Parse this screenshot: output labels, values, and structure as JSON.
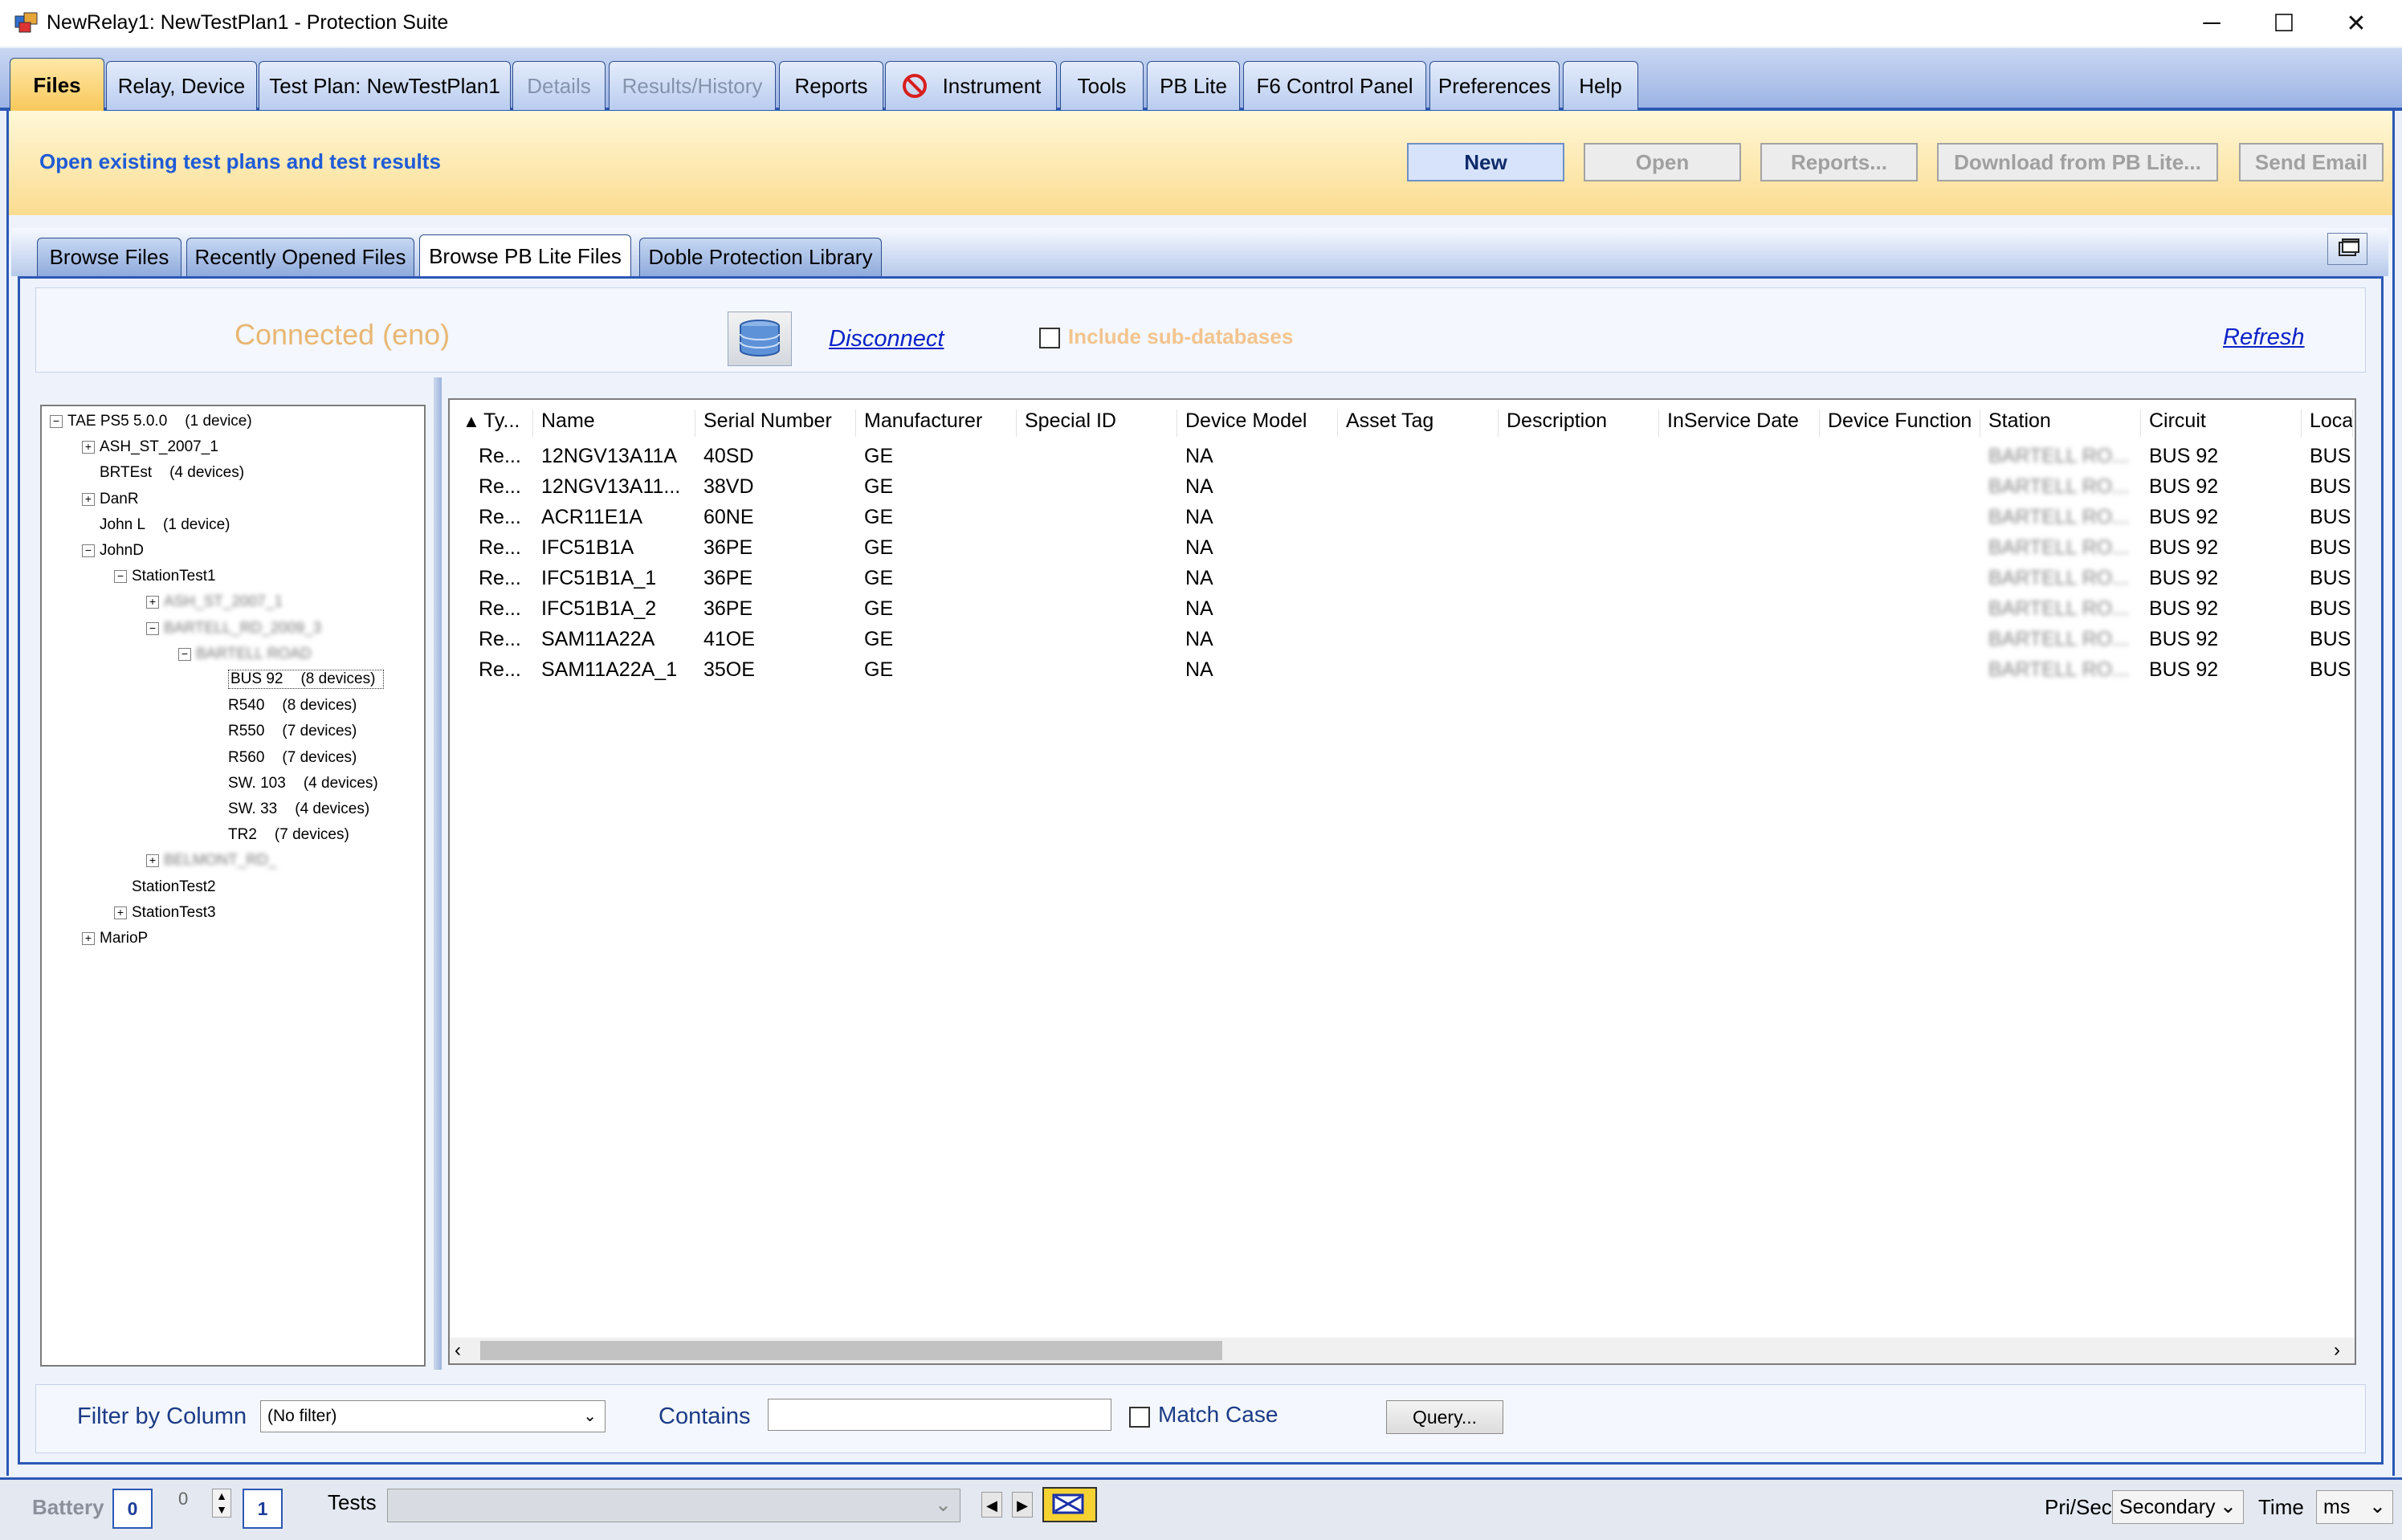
{
  "window": {
    "title": "NewRelay1: NewTestPlan1 - Protection Suite",
    "minimize": "─",
    "maximize": "☐",
    "close": "✕"
  },
  "main_tabs": [
    {
      "label": "Files",
      "state": "active"
    },
    {
      "label": "Relay, Device",
      "state": "normal"
    },
    {
      "label": "Test Plan: NewTestPlan1",
      "state": "normal"
    },
    {
      "label": "Details",
      "state": "disabled"
    },
    {
      "label": "Results/History",
      "state": "disabled"
    },
    {
      "label": "Reports",
      "state": "normal"
    },
    {
      "label": "Instrument",
      "state": "normal",
      "icon": "no-entry-icon"
    },
    {
      "label": "Tools",
      "state": "normal"
    },
    {
      "label": "PB Lite",
      "state": "normal"
    },
    {
      "label": "F6 Control Panel",
      "state": "normal"
    },
    {
      "label": "Preferences",
      "state": "normal"
    },
    {
      "label": "Help",
      "state": "normal"
    }
  ],
  "header": {
    "title": "Open existing test plans and test results",
    "buttons": [
      {
        "label": "New",
        "enabled": true
      },
      {
        "label": "Open",
        "enabled": false
      },
      {
        "label": "Reports...",
        "enabled": false
      },
      {
        "label": "Download from PB Lite...",
        "enabled": false
      },
      {
        "label": "Send Email",
        "enabled": false
      }
    ]
  },
  "sub_tabs": [
    {
      "label": "Browse Files",
      "active": false
    },
    {
      "label": "Recently Opened Files",
      "active": false
    },
    {
      "label": "Browse PB Lite Files",
      "active": true
    },
    {
      "label": "Doble Protection Library",
      "active": false
    }
  ],
  "connection": {
    "status": "Connected (eno)",
    "disconnect": "Disconnect",
    "include_sub": "Include sub-databases",
    "include_sub_checked": false,
    "refresh": "Refresh"
  },
  "tree": [
    {
      "label": "TAE PS5 5.0.0",
      "count": "(1 device)",
      "level": 0,
      "expander": "−"
    },
    {
      "label": "ASH_ST_2007_1",
      "count": "",
      "level": 1,
      "expander": "+"
    },
    {
      "label": "BRTEst",
      "count": "(4 devices)",
      "level": 1,
      "expander": ""
    },
    {
      "label": "DanR",
      "count": "",
      "level": 1,
      "expander": "+"
    },
    {
      "label": "John L",
      "count": "(1 device)",
      "level": 1,
      "expander": ""
    },
    {
      "label": "JohnD",
      "count": "",
      "level": 1,
      "expander": "−"
    },
    {
      "label": "StationTest1",
      "count": "",
      "level": 2,
      "expander": "−"
    },
    {
      "label": "ASH_ST_2007_1",
      "count": "",
      "level": 3,
      "expander": "+",
      "blurred": true
    },
    {
      "label": "BARTELL_RD_2009_3",
      "count": "",
      "level": 3,
      "expander": "−",
      "blurred": true
    },
    {
      "label": "BARTELL ROAD",
      "count": "",
      "level": 4,
      "expander": "−",
      "blurred": true
    },
    {
      "label": "BUS 92",
      "count": "(8 devices)",
      "level": 5,
      "expander": "",
      "selected": true
    },
    {
      "label": "R540",
      "count": "(8 devices)",
      "level": 5,
      "expander": ""
    },
    {
      "label": "R550",
      "count": "(7 devices)",
      "level": 5,
      "expander": ""
    },
    {
      "label": "R560",
      "count": "(7 devices)",
      "level": 5,
      "expander": ""
    },
    {
      "label": "SW. 103",
      "count": "(4 devices)",
      "level": 5,
      "expander": ""
    },
    {
      "label": "SW. 33",
      "count": "(4 devices)",
      "level": 5,
      "expander": ""
    },
    {
      "label": "TR2",
      "count": "(7 devices)",
      "level": 5,
      "expander": ""
    },
    {
      "label": "BELMONT_RD_",
      "count": "",
      "level": 3,
      "expander": "+",
      "blurred": true
    },
    {
      "label": "StationTest2",
      "count": "",
      "level": 2,
      "expander": ""
    },
    {
      "label": "StationTest3",
      "count": "",
      "level": 2,
      "expander": "+"
    },
    {
      "label": "MarioP",
      "count": "",
      "level": 1,
      "expander": "+"
    }
  ],
  "grid": {
    "sort_indicator": "▲",
    "columns": [
      "Ty...",
      "Name",
      "Serial Number",
      "Manufacturer",
      "Special ID",
      "Device Model",
      "Asset Tag",
      "Description",
      "InService Date",
      "Device Function",
      "Station",
      "Circuit",
      "Loca"
    ],
    "rows": [
      [
        "Re...",
        "12NGV13A11A",
        "40SD",
        "GE",
        "",
        "NA",
        "",
        "",
        "",
        "",
        "BARTELL RO...",
        "BUS 92",
        "BUS"
      ],
      [
        "Re...",
        "12NGV13A11...",
        "38VD",
        "GE",
        "",
        "NA",
        "",
        "",
        "",
        "",
        "BARTELL RO...",
        "BUS 92",
        "BUS"
      ],
      [
        "Re...",
        "ACR11E1A",
        "60NE",
        "GE",
        "",
        "NA",
        "",
        "",
        "",
        "",
        "BARTELL RO...",
        "BUS 92",
        "BUS"
      ],
      [
        "Re...",
        "IFC51B1A",
        "36PE",
        "GE",
        "",
        "NA",
        "",
        "",
        "",
        "",
        "BARTELL RO...",
        "BUS 92",
        "BUS"
      ],
      [
        "Re...",
        "IFC51B1A_1",
        "36PE",
        "GE",
        "",
        "NA",
        "",
        "",
        "",
        "",
        "BARTELL RO...",
        "BUS 92",
        "BUS"
      ],
      [
        "Re...",
        "IFC51B1A_2",
        "36PE",
        "GE",
        "",
        "NA",
        "",
        "",
        "",
        "",
        "BARTELL RO...",
        "BUS 92",
        "BUS"
      ],
      [
        "Re...",
        "SAM11A22A",
        "41OE",
        "GE",
        "",
        "NA",
        "",
        "",
        "",
        "",
        "BARTELL RO...",
        "BUS 92",
        "BUS"
      ],
      [
        "Re...",
        "SAM11A22A_1",
        "35OE",
        "GE",
        "",
        "NA",
        "",
        "",
        "",
        "",
        "BARTELL RO...",
        "BUS 92",
        "BUS"
      ]
    ]
  },
  "filter": {
    "filter_by_label": "Filter by Column",
    "filter_value": "(No filter)",
    "contains_label": "Contains",
    "contains_value": "",
    "match_case": "Match Case",
    "match_case_checked": false,
    "query": "Query..."
  },
  "status": {
    "battery_label": "Battery",
    "battery_value": "0",
    "spinner_value": "0",
    "spinner_max": "1",
    "tests_label": "Tests",
    "tests_value": "",
    "prisec_label": "Pri/Sec",
    "prisec_value": "Secondary",
    "time_label": "Time",
    "time_value": "ms"
  },
  "colors": {
    "accent_blue": "#2c58b6",
    "header_title": "#1f5bd6",
    "connected_text": "#e8b774",
    "active_tab": "#f8c85a",
    "link": "#0b22c8"
  }
}
